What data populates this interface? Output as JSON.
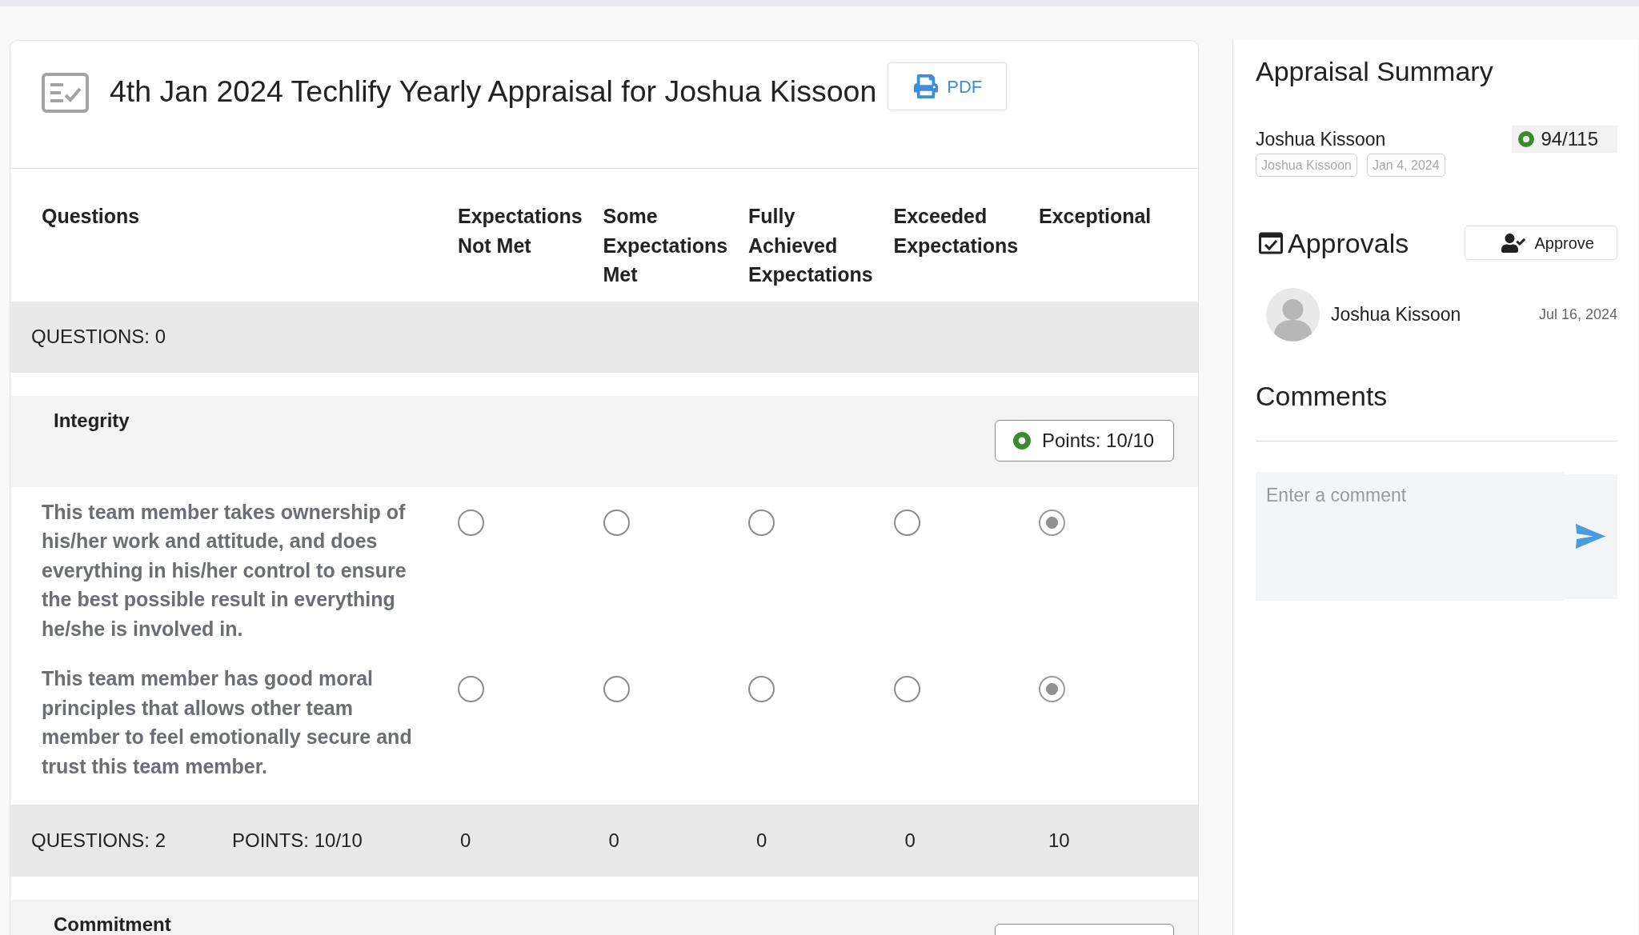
{
  "header": {
    "title": "4th Jan 2024 Techlify Yearly Appraisal for Joshua Kissoon",
    "pdf_button": "PDF"
  },
  "table": {
    "columns": [
      "Questions",
      "Expectations Not Met",
      "Some Expectations Met",
      "Fully Achieved Expectations",
      "Exceeded Expectations",
      "Exceptional"
    ],
    "opening_total": "QUESTIONS: 0",
    "sections": [
      {
        "title": "Integrity",
        "points": "Points: 10/10",
        "questions": [
          {
            "text": "This team member takes ownership of his/her work and attitude, and does everything in his/her control to ensure the best possible result in everything he/she is involved in.",
            "options": [
              {
                "selected": false
              },
              {
                "selected": false
              },
              {
                "selected": false
              },
              {
                "selected": false
              },
              {
                "selected": true
              }
            ]
          },
          {
            "text": "This team member has good moral principles that allows other team member to feel emotionally secure and trust this team member.",
            "options": [
              {
                "selected": false
              },
              {
                "selected": false
              },
              {
                "selected": false
              },
              {
                "selected": false
              },
              {
                "selected": true
              }
            ]
          }
        ],
        "totals": {
          "questions": "QUESTIONS: 2",
          "points": "POINTS: 10/10",
          "columns": [
            "0",
            "0",
            "0",
            "0",
            "10"
          ]
        }
      },
      {
        "title": "Commitment"
      }
    ]
  },
  "summary": {
    "title": "Appraisal Summary",
    "employee": "Joshua Kissoon",
    "score": "94/115",
    "tags": [
      "Joshua Kissoon",
      "Jan 4, 2024"
    ]
  },
  "approvals": {
    "title": "Approvals",
    "approve_button": "Approve",
    "items": [
      {
        "name": "Joshua Kissoon",
        "date": "Jul 16, 2024"
      }
    ]
  },
  "comments": {
    "title": "Comments",
    "placeholder": "Enter a comment"
  }
}
